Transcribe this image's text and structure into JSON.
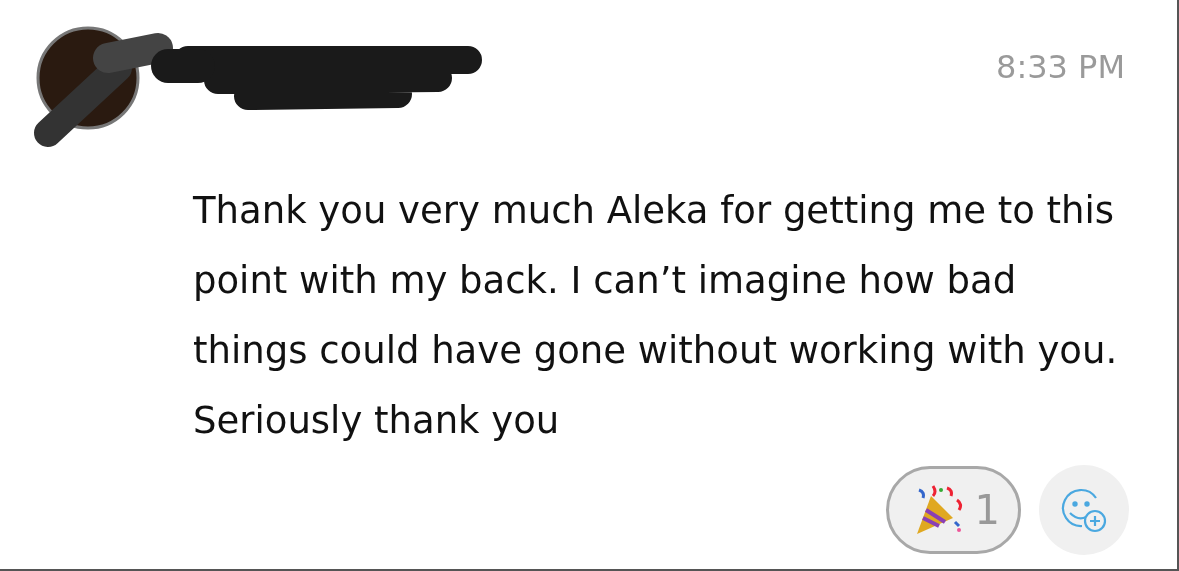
{
  "message": {
    "time": "8:33 PM",
    "text": "Thank you very much Aleka for getting me to this point with my back. I can’t imagine how bad things could have gone without working with you. Seriously thank you"
  },
  "reactions": [
    {
      "kind": "party",
      "count": "1",
      "selected": true
    }
  ]
}
